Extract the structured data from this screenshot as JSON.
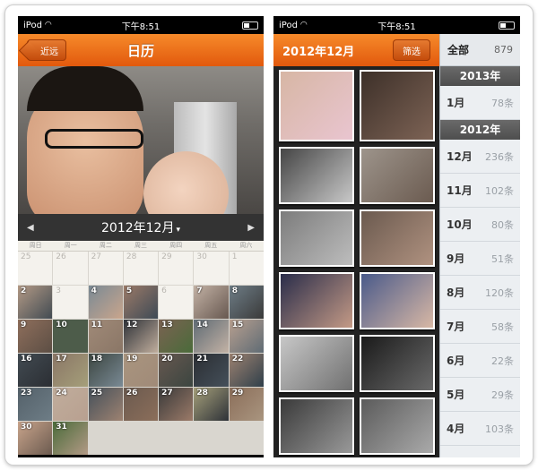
{
  "left_screen": {
    "status": {
      "carrier": "iPod",
      "time": "下午8:51"
    },
    "nav": {
      "back_label": "近远",
      "title": "日历"
    },
    "month_title": "2012年12月",
    "weekdays": [
      "周日",
      "周一",
      "周二",
      "周三",
      "周四",
      "周五",
      "周六"
    ],
    "days": [
      "25",
      "26",
      "27",
      "28",
      "29",
      "30",
      "1",
      "2",
      "3",
      "4",
      "5",
      "6",
      "7",
      "8",
      "9",
      "10",
      "11",
      "12",
      "13",
      "14",
      "15",
      "16",
      "17",
      "18",
      "19",
      "20",
      "21",
      "22",
      "23",
      "24",
      "25",
      "26",
      "27",
      "28",
      "29",
      "30",
      "31"
    ]
  },
  "right_screen": {
    "status": {
      "carrier": "iPod",
      "time": "下午8:51"
    },
    "header": {
      "title": "2012年12月",
      "filter_label": "筛选"
    },
    "all": {
      "label": "全部",
      "count": "879"
    },
    "years": [
      {
        "year": "2013年",
        "months": [
          {
            "label": "1月",
            "count": "78条"
          }
        ]
      },
      {
        "year": "2012年",
        "months": [
          {
            "label": "12月",
            "count": "236条"
          },
          {
            "label": "11月",
            "count": "102条"
          },
          {
            "label": "10月",
            "count": "80条"
          },
          {
            "label": "9月",
            "count": "51条"
          },
          {
            "label": "8月",
            "count": "120条"
          },
          {
            "label": "7月",
            "count": "58条"
          },
          {
            "label": "6月",
            "count": "22条"
          },
          {
            "label": "5月",
            "count": "29条"
          },
          {
            "label": "4月",
            "count": "103条"
          }
        ]
      }
    ]
  },
  "colors": {
    "accent": "#f07a1f",
    "nav_dark": "#e2590d"
  }
}
